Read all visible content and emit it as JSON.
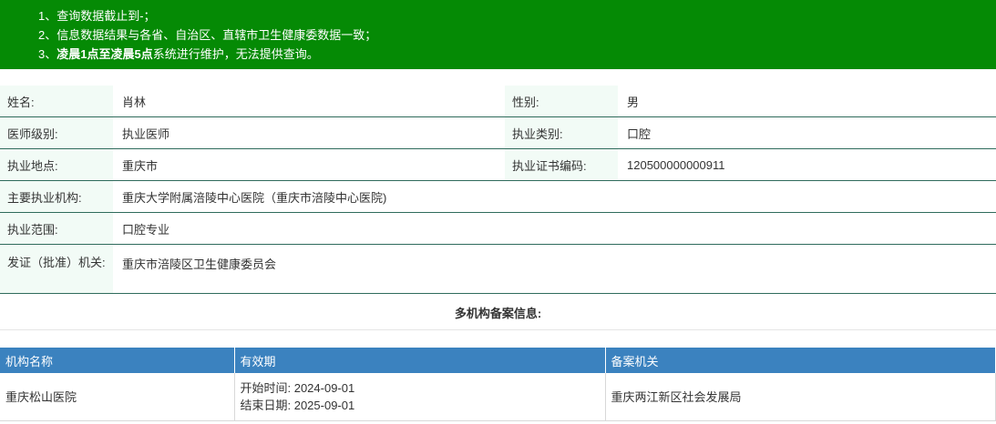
{
  "notice": {
    "line1": "1、查询数据截止到-；",
    "line2": "2、信息数据结果与各省、自治区、直辖市卫生健康委数据一致；",
    "line3_prefix": "3、",
    "line3_bold": "凌晨1点至凌晨5点",
    "line3_suffix": "系统进行维护，无法提供查询。"
  },
  "info": {
    "name_label": "姓名:",
    "name_value": "肖林",
    "gender_label": "性别:",
    "gender_value": "男",
    "level_label": "医师级别:",
    "level_value": "执业医师",
    "category_label": "执业类别:",
    "category_value": "口腔",
    "location_label": "执业地点:",
    "location_value": "重庆市",
    "cert_label": "执业证书编码:",
    "cert_value": "120500000000911",
    "org_label": "主要执业机构:",
    "org_value": "重庆大学附属涪陵中心医院（重庆市涪陵中心医院)",
    "scope_label": "执业范围:",
    "scope_value": "口腔专业",
    "issuer_label": "发证（批准）机关:",
    "issuer_value": "重庆市涪陵区卫生健康委员会"
  },
  "multi_title": "多机构备案信息:",
  "orgs_table": {
    "headers": [
      "机构名称",
      "有效期",
      "备案机关"
    ],
    "rows": [
      {
        "name": "重庆松山医院",
        "start": "开始时间:   2024-09-01",
        "end": "结束日期:   2025-09-01",
        "authority": "重庆两江新区社会发展局"
      }
    ]
  }
}
